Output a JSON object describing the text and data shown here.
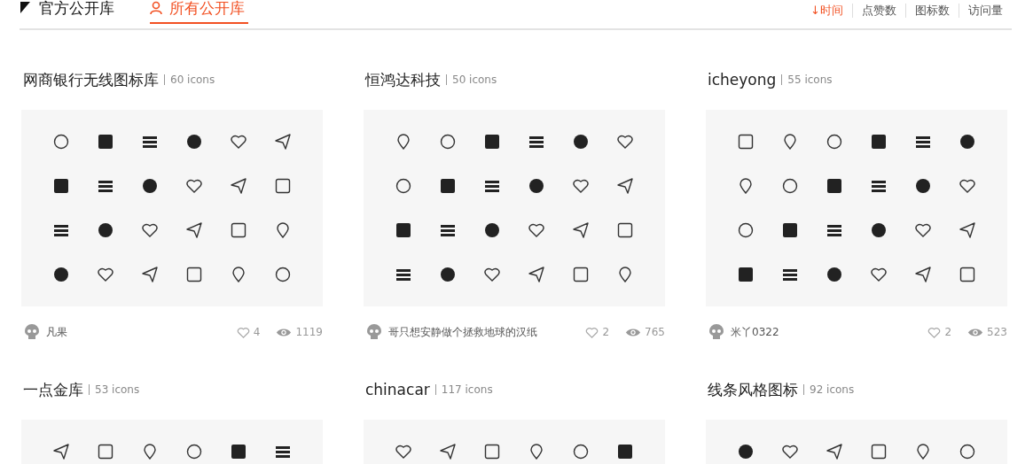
{
  "tabs": [
    {
      "label": "官方公开库",
      "selected": false
    },
    {
      "label": "所有公开库",
      "selected": true
    }
  ],
  "sort": [
    {
      "label": "↓时间",
      "selected": true
    },
    {
      "label": "点赞数",
      "selected": false
    },
    {
      "label": "图标数",
      "selected": false
    },
    {
      "label": "访问量",
      "selected": false
    }
  ],
  "libraries": [
    {
      "title": "网商银行无线图标库",
      "count": "60 icons",
      "author": "凡果",
      "likes": "4",
      "views": "1119"
    },
    {
      "title": "恒鸿达科技",
      "count": "50 icons",
      "author": "哥只想安静做个拯救地球的汉纸",
      "likes": "2",
      "views": "765"
    },
    {
      "title": "icheyong",
      "count": "55 icons",
      "author": "米丫0322",
      "likes": "2",
      "views": "523"
    },
    {
      "title": "一点金库",
      "count": "53 icons"
    },
    {
      "title": "chinacar",
      "count": "117 icons"
    },
    {
      "title": "线条风格图标",
      "count": "92 icons"
    }
  ]
}
